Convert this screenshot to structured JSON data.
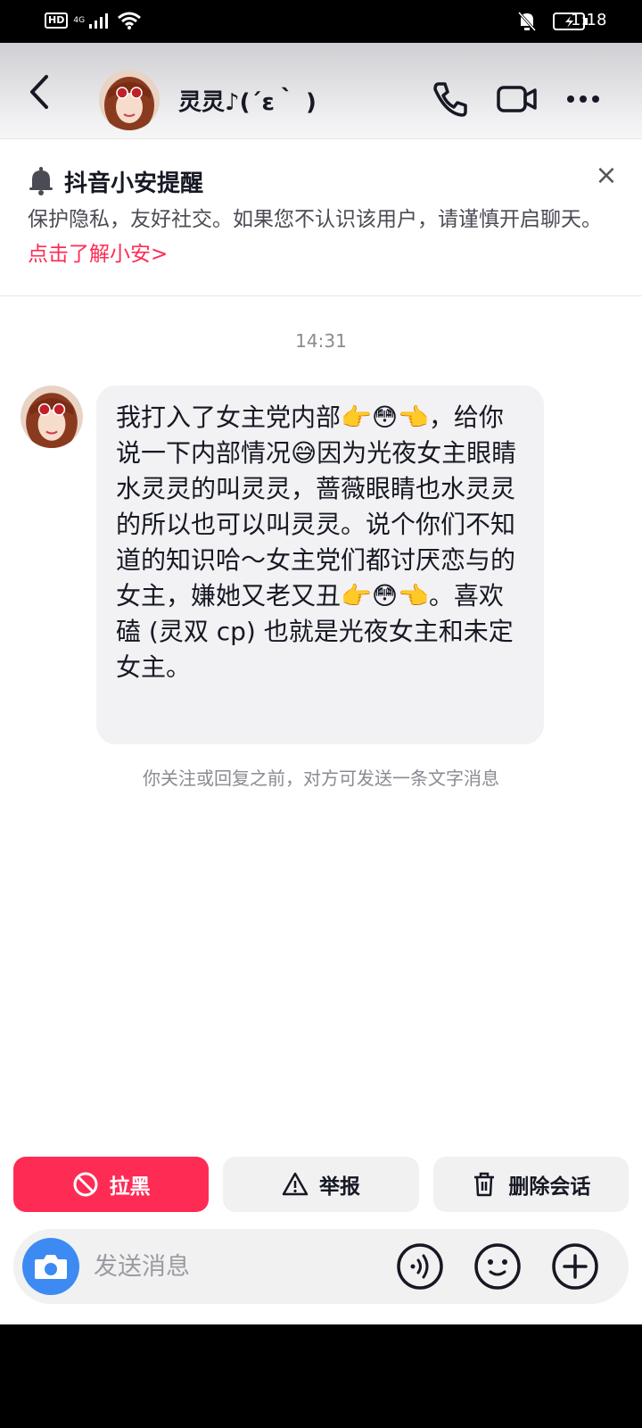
{
  "status_bar": {
    "hd": "HD",
    "network": "4G",
    "time": "1:18"
  },
  "header": {
    "contact_name": "灵灵♪(´ε｀ )",
    "icons": [
      "back-icon",
      "phone-icon",
      "video-icon",
      "more-icon"
    ]
  },
  "notice": {
    "title": "抖音小安提醒",
    "body": "保护隐私，友好社交。如果您不认识该用户，请谨慎开启聊天。",
    "link": "点击了解小安>",
    "close": "×"
  },
  "chat": {
    "timestamp": "14:31",
    "message": "我打入了女主党内部👉😳👈，给你说一下内部情况😅因为光夜女主眼睛水灵灵的叫灵灵，蔷薇眼睛也水灵灵的所以也可以叫灵灵。说个你们不知道的知识哈～女主党们都讨厌恋与的女主，嫌她又老又丑👉😳👈。喜欢磕 (灵双 cp) 也就是光夜女主和未定女主。",
    "hint": "你关注或回复之前，对方可发送一条文字消息"
  },
  "actions": {
    "block": "拉黑",
    "report": "举报",
    "delete": "删除会话"
  },
  "input": {
    "placeholder": "发送消息"
  },
  "colors": {
    "accent": "#fe2c55",
    "camera": "#3d8bf2",
    "bubble": "#f2f2f4"
  }
}
